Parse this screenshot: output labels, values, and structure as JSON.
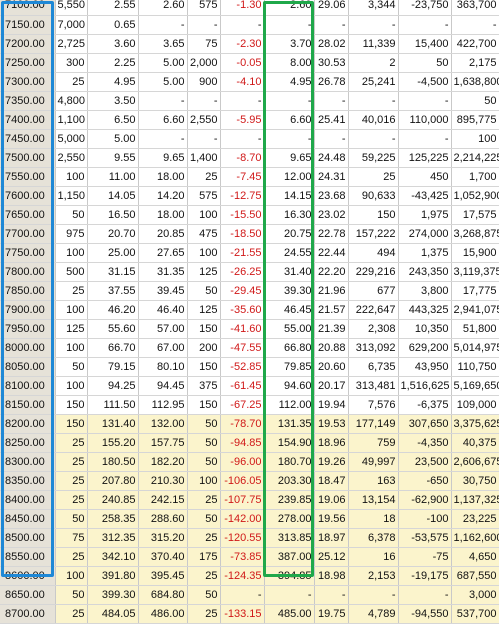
{
  "columns": [
    "strike",
    "vol_a",
    "bid",
    "ask",
    "vol_b",
    "change",
    "last",
    "iv",
    "open_interest",
    "oi_change",
    "premium"
  ],
  "colors": {
    "positive": "#111111",
    "negative": "#d01818",
    "itm_bg": "#fbf4cc",
    "strike_bg": "#e6e2d8",
    "strike_box": "#1e88d6",
    "last_box": "#1fa84a"
  },
  "rows": [
    {
      "itm": false,
      "cells": [
        "7100.00",
        "5,550",
        "2.55",
        "2.60",
        "575",
        "-1.30",
        "2.60",
        "29.06",
        "3,344",
        "-23,750",
        "363,700"
      ]
    },
    {
      "itm": false,
      "cells": [
        "7150.00",
        "7,000",
        "0.65",
        "-",
        "-",
        "-",
        "-",
        "-",
        "-",
        "-",
        "-"
      ]
    },
    {
      "itm": false,
      "cells": [
        "7200.00",
        "2,725",
        "3.60",
        "3.65",
        "75",
        "-2.30",
        "3.70",
        "28.02",
        "11,339",
        "15,400",
        "422,700"
      ]
    },
    {
      "itm": false,
      "cells": [
        "7250.00",
        "300",
        "2.25",
        "5.00",
        "2,000",
        "-0.05",
        "8.00",
        "30.53",
        "2",
        "50",
        "2,175"
      ]
    },
    {
      "itm": false,
      "cells": [
        "7300.00",
        "25",
        "4.95",
        "5.00",
        "900",
        "-4.10",
        "4.95",
        "26.78",
        "25,241",
        "-4,500",
        "1,638,800"
      ]
    },
    {
      "itm": false,
      "cells": [
        "7350.00",
        "4,800",
        "3.50",
        "-",
        "-",
        "-",
        "-",
        "-",
        "-",
        "-",
        "50"
      ]
    },
    {
      "itm": false,
      "cells": [
        "7400.00",
        "1,100",
        "6.50",
        "6.60",
        "2,550",
        "-5.95",
        "6.60",
        "25.41",
        "40,016",
        "110,000",
        "895,775"
      ]
    },
    {
      "itm": false,
      "cells": [
        "7450.00",
        "5,000",
        "5.00",
        "-",
        "-",
        "-",
        "-",
        "-",
        "-",
        "-",
        "100"
      ]
    },
    {
      "itm": false,
      "cells": [
        "7500.00",
        "2,550",
        "9.55",
        "9.65",
        "1,400",
        "-8.70",
        "9.65",
        "24.48",
        "59,225",
        "125,225",
        "2,214,225"
      ]
    },
    {
      "itm": false,
      "cells": [
        "7550.00",
        "100",
        "11.00",
        "18.00",
        "25",
        "-7.45",
        "12.00",
        "24.31",
        "25",
        "450",
        "1,700"
      ]
    },
    {
      "itm": false,
      "cells": [
        "7600.00",
        "1,150",
        "14.05",
        "14.20",
        "575",
        "-12.75",
        "14.15",
        "23.68",
        "90,633",
        "-43,425",
        "1,052,900"
      ]
    },
    {
      "itm": false,
      "cells": [
        "7650.00",
        "50",
        "16.50",
        "18.00",
        "100",
        "-15.50",
        "16.30",
        "23.02",
        "150",
        "1,975",
        "17,575"
      ]
    },
    {
      "itm": false,
      "cells": [
        "7700.00",
        "975",
        "20.70",
        "20.85",
        "475",
        "-18.50",
        "20.75",
        "22.78",
        "157,222",
        "274,000",
        "3,268,875"
      ]
    },
    {
      "itm": false,
      "cells": [
        "7750.00",
        "100",
        "25.00",
        "27.65",
        "100",
        "-21.55",
        "24.55",
        "22.44",
        "494",
        "1,375",
        "15,900"
      ]
    },
    {
      "itm": false,
      "cells": [
        "7800.00",
        "500",
        "31.15",
        "31.35",
        "125",
        "-26.25",
        "31.40",
        "22.20",
        "229,216",
        "243,350",
        "3,119,375"
      ]
    },
    {
      "itm": false,
      "cells": [
        "7850.00",
        "25",
        "37.55",
        "39.45",
        "50",
        "-29.45",
        "39.30",
        "21.96",
        "677",
        "3,800",
        "17,775"
      ]
    },
    {
      "itm": false,
      "cells": [
        "7900.00",
        "100",
        "46.20",
        "46.40",
        "125",
        "-35.60",
        "46.45",
        "21.57",
        "222,647",
        "443,325",
        "2,941,075"
      ]
    },
    {
      "itm": false,
      "cells": [
        "7950.00",
        "125",
        "55.60",
        "57.00",
        "150",
        "-41.60",
        "55.00",
        "21.39",
        "2,308",
        "10,350",
        "51,800"
      ]
    },
    {
      "itm": false,
      "cells": [
        "8000.00",
        "100",
        "66.70",
        "67.00",
        "200",
        "-47.55",
        "66.80",
        "20.88",
        "313,092",
        "629,200",
        "5,014,975"
      ]
    },
    {
      "itm": false,
      "cells": [
        "8050.00",
        "50",
        "79.15",
        "80.10",
        "150",
        "-52.85",
        "79.85",
        "20.60",
        "6,735",
        "43,950",
        "110,750"
      ]
    },
    {
      "itm": false,
      "cells": [
        "8100.00",
        "100",
        "94.25",
        "94.45",
        "375",
        "-61.45",
        "94.60",
        "20.17",
        "313,481",
        "1,516,625",
        "5,169,650"
      ]
    },
    {
      "itm": false,
      "cells": [
        "8150.00",
        "150",
        "111.50",
        "112.95",
        "150",
        "-67.25",
        "112.00",
        "19.94",
        "7,576",
        "-6,375",
        "109,000"
      ]
    },
    {
      "itm": true,
      "cells": [
        "8200.00",
        "150",
        "131.40",
        "132.00",
        "50",
        "-78.70",
        "131.35",
        "19.53",
        "177,149",
        "307,650",
        "3,375,625"
      ]
    },
    {
      "itm": true,
      "cells": [
        "8250.00",
        "25",
        "155.20",
        "157.75",
        "50",
        "-94.85",
        "154.90",
        "18.96",
        "759",
        "-4,350",
        "40,375"
      ]
    },
    {
      "itm": true,
      "cells": [
        "8300.00",
        "25",
        "180.50",
        "182.20",
        "50",
        "-96.00",
        "180.70",
        "19.26",
        "49,997",
        "23,500",
        "2,606,675"
      ]
    },
    {
      "itm": true,
      "cells": [
        "8350.00",
        "25",
        "207.80",
        "210.30",
        "100",
        "-106.05",
        "203.30",
        "18.47",
        "163",
        "-650",
        "30,750"
      ]
    },
    {
      "itm": true,
      "cells": [
        "8400.00",
        "25",
        "240.85",
        "242.15",
        "25",
        "-107.75",
        "239.85",
        "19.06",
        "13,154",
        "-62,900",
        "1,137,325"
      ]
    },
    {
      "itm": true,
      "cells": [
        "8450.00",
        "50",
        "258.35",
        "288.60",
        "50",
        "-142.00",
        "278.00",
        "19.56",
        "18",
        "-100",
        "23,225"
      ]
    },
    {
      "itm": true,
      "cells": [
        "8500.00",
        "75",
        "312.35",
        "315.20",
        "25",
        "-120.55",
        "313.85",
        "18.97",
        "6,378",
        "-53,575",
        "1,162,600"
      ]
    },
    {
      "itm": true,
      "cells": [
        "8550.00",
        "25",
        "342.10",
        "370.40",
        "175",
        "-73.85",
        "387.00",
        "25.12",
        "16",
        "-75",
        "4,650"
      ]
    },
    {
      "itm": true,
      "cells": [
        "8600.00",
        "100",
        "391.80",
        "395.45",
        "25",
        "-124.35",
        "394.85",
        "18.98",
        "2,153",
        "-19,175",
        "687,550"
      ]
    },
    {
      "itm": true,
      "cells": [
        "8650.00",
        "50",
        "399.30",
        "684.80",
        "50",
        "-",
        "-",
        "-",
        "-",
        "-",
        "3,000"
      ]
    },
    {
      "itm": true,
      "cells": [
        "8700.00",
        "25",
        "484.05",
        "486.00",
        "25",
        "-133.15",
        "485.00",
        "19.75",
        "4,789",
        "-94,550",
        "537,700"
      ]
    }
  ]
}
